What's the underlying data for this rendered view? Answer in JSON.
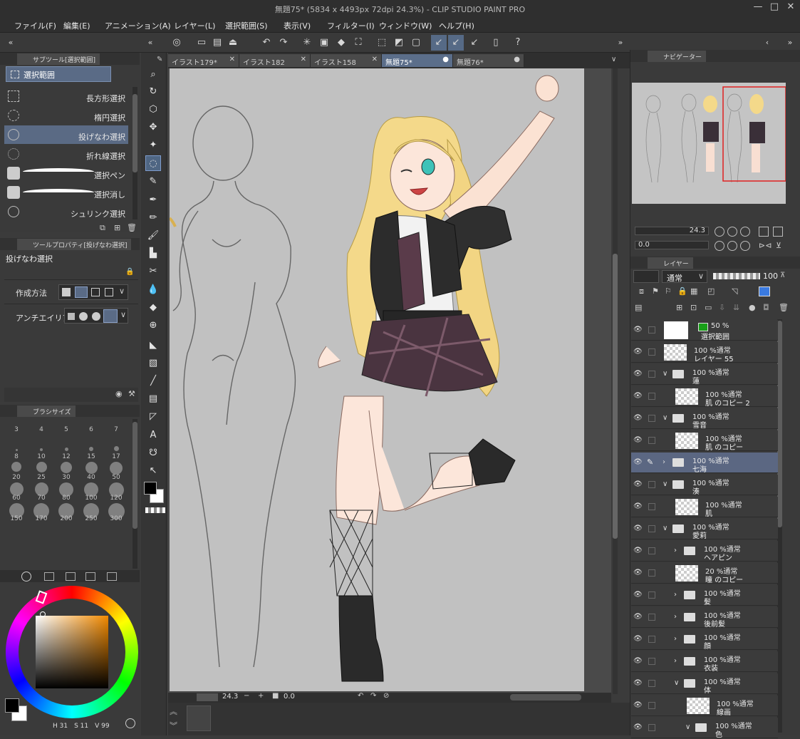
{
  "window": {
    "title": "無題75* (5834 x 4493px 72dpi 24.3%) - CLIP STUDIO PAINT PRO",
    "min": "—",
    "max": "□",
    "close": "✕"
  },
  "menu": [
    "ファイル(F)",
    "編集(E)",
    "アニメーション(A)",
    "レイヤー(L)",
    "選択範囲(S)",
    "表示(V)",
    "フィルター(I)",
    "ウィンドウ(W)",
    "ヘルプ(H)"
  ],
  "subtool": {
    "tab": "サブツール[選択範囲]",
    "group": "選択範囲",
    "items": [
      "長方形選択",
      "楕円選択",
      "投げなわ選択",
      "折れ線選択",
      "選択ペン",
      "選択消し",
      "シュリンク選択"
    ]
  },
  "toolprop": {
    "tab": "ツールプロパティ[投げなわ選択]",
    "tool_name": "投げなわ選択",
    "method_label": "作成方法",
    "aa_label": "アンチエイリアス"
  },
  "brushsize": {
    "tab": "ブラシサイズ",
    "sizes": [
      "3",
      "4",
      "5",
      "6",
      "7",
      "8",
      "10",
      "12",
      "15",
      "17",
      "20",
      "25",
      "30",
      "40",
      "50",
      "60",
      "70",
      "80",
      "100",
      "120",
      "150",
      "170",
      "200",
      "250",
      "300"
    ]
  },
  "color": {
    "fg": "#000000",
    "bg": "#ffffff",
    "hue_marker": "#e08a1c",
    "readout": [
      "31",
      "11",
      "99"
    ]
  },
  "doc_tabs": [
    {
      "label": "イラスト179*",
      "active": false
    },
    {
      "label": "イラスト182",
      "active": false
    },
    {
      "label": "イラスト158",
      "active": false
    },
    {
      "label": "無題75*",
      "active": true
    },
    {
      "label": "無題76*",
      "active": false
    }
  ],
  "canvas_status": {
    "zoom": "24.3",
    "angle": "0.0"
  },
  "navigator": {
    "tab": "ナビゲーター",
    "zoom": "24.3",
    "angle": "0.0"
  },
  "layer_panel": {
    "tab": "レイヤー",
    "blend": "通常",
    "opacity": "100"
  },
  "layers": [
    {
      "l1": "50 %",
      "l2": "選択範囲",
      "kind": "white",
      "indent": 0,
      "arrow": ""
    },
    {
      "l1": "100 %通常",
      "l2": "レイヤー 55",
      "kind": "checker",
      "indent": 0,
      "arrow": ""
    },
    {
      "l1": "100 %通常",
      "l2": "蓮",
      "kind": "folder",
      "indent": 0,
      "arrow": "∨"
    },
    {
      "l1": "100 %通常",
      "l2": "肌 のコピー 2",
      "kind": "checker",
      "indent": 1,
      "arrow": ""
    },
    {
      "l1": "100 %通常",
      "l2": "雪音",
      "kind": "folder",
      "indent": 0,
      "arrow": "∨"
    },
    {
      "l1": "100 %通常",
      "l2": "肌 のコピー",
      "kind": "checker",
      "indent": 1,
      "arrow": ""
    },
    {
      "l1": "100 %通常",
      "l2": "七海",
      "kind": "folder",
      "indent": 0,
      "arrow": "›",
      "selected": true
    },
    {
      "l1": "100 %通常",
      "l2": "湊",
      "kind": "folder",
      "indent": 0,
      "arrow": "∨"
    },
    {
      "l1": "100 %通常",
      "l2": "肌",
      "kind": "checker",
      "indent": 1,
      "arrow": ""
    },
    {
      "l1": "100 %通常",
      "l2": "愛莉",
      "kind": "folder",
      "indent": 0,
      "arrow": "∨"
    },
    {
      "l1": "100 %通常",
      "l2": "ヘアピン",
      "kind": "folder",
      "indent": 1,
      "arrow": "›"
    },
    {
      "l1": "20 %通常",
      "l2": "瞳 のコピー",
      "kind": "checker",
      "indent": 1,
      "arrow": ""
    },
    {
      "l1": "100 %通常",
      "l2": "髪",
      "kind": "folder",
      "indent": 1,
      "arrow": "›"
    },
    {
      "l1": "100 %通常",
      "l2": "後前髪",
      "kind": "folder",
      "indent": 1,
      "arrow": "›"
    },
    {
      "l1": "100 %通常",
      "l2": "顔",
      "kind": "folder",
      "indent": 1,
      "arrow": "›"
    },
    {
      "l1": "100 %通常",
      "l2": "衣装",
      "kind": "folder",
      "indent": 1,
      "arrow": "›"
    },
    {
      "l1": "100 %通常",
      "l2": "体",
      "kind": "folder",
      "indent": 1,
      "arrow": "∨"
    },
    {
      "l1": "100 %通常",
      "l2": "線画",
      "kind": "checker",
      "indent": 2,
      "arrow": ""
    },
    {
      "l1": "100 %通常",
      "l2": "色",
      "kind": "folder",
      "indent": 2,
      "arrow": "∨"
    }
  ]
}
